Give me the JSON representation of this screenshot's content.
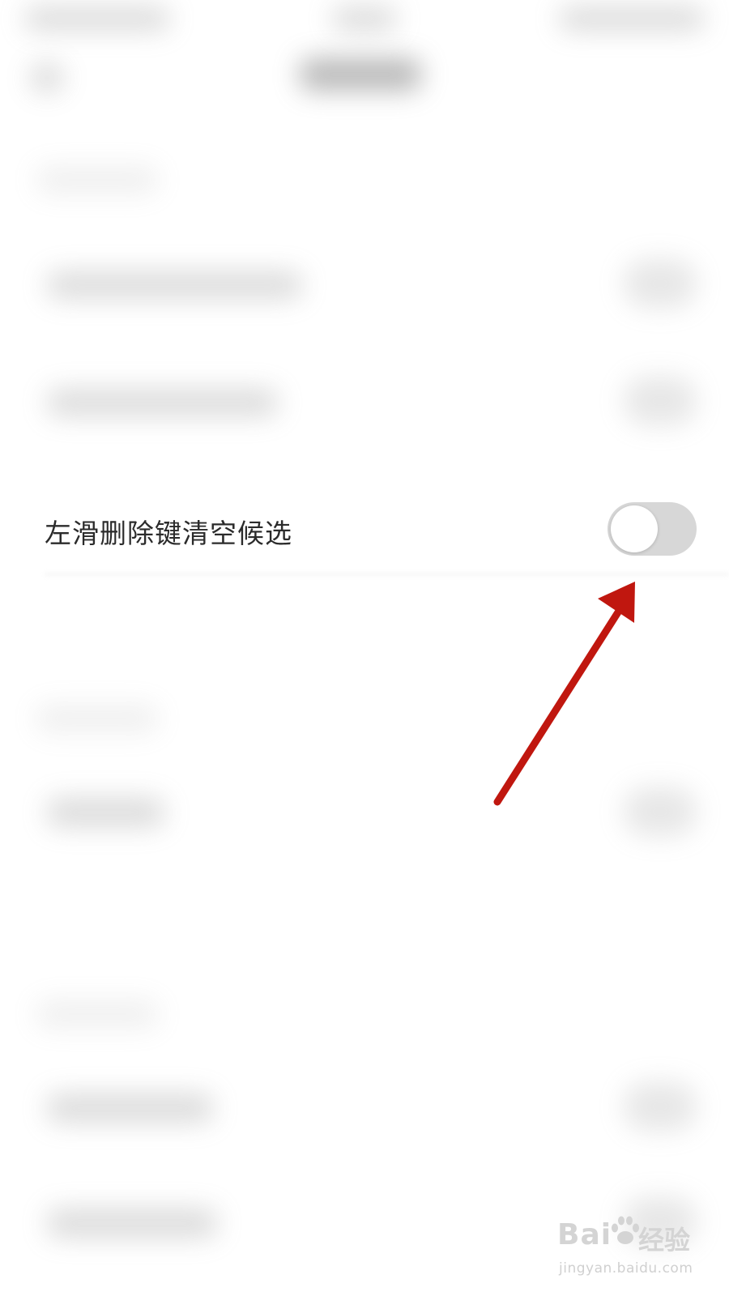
{
  "setting": {
    "label": "左滑删除键清空候选",
    "enabled": false
  },
  "colors": {
    "toggle_track_off": "#d7d7d7",
    "toggle_knob": "#ffffff",
    "annotation_arrow": "#c0170f",
    "watermark": "#d0d0d0"
  },
  "watermark": {
    "logo": "Bai",
    "brand": "经验",
    "url": "jingyan.baidu.com"
  }
}
